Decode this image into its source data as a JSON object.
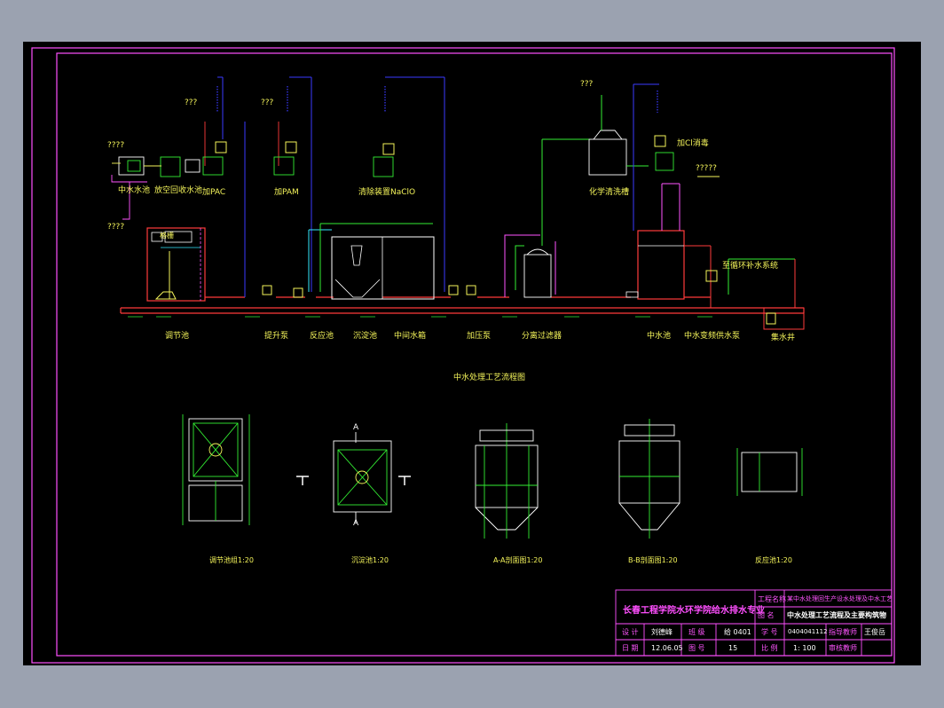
{
  "flow_title": "中水处理工艺流程图",
  "process_labels": {
    "reuse_pool": "中水水池",
    "air_dryer": "放空回收水池",
    "pac": "加PAC",
    "pam": "加PAM",
    "naclo": "清除装置NaClO",
    "chem_clean": "化学清洗槽",
    "cl_disinfect": "加Cl消毒",
    "reuse_system": "至循环补水系统",
    "equalization": "调节池",
    "lift_pump": "提升泵",
    "reaction": "反应池",
    "sedimentation": "沉淀池",
    "intermediate": "中间水箱",
    "booster": "加压泵",
    "membrane": "分离过滤器",
    "reuse_tank": "中水池",
    "reuse_pump": "中水变频供水泵",
    "collect_well": "集水井",
    "tank_tag": "格栅"
  },
  "unknown_marks": {
    "q4a": "????",
    "q4b": "????",
    "q3a": "???",
    "q3b": "???",
    "q3c": "???",
    "q3d": "???",
    "q5": "?????"
  },
  "section_labels": {
    "sec1": "调节池组1:20",
    "sec2": "沉淀池1:20",
    "sec3": "A-A剖面图1:20",
    "sec4": "B-B剖面图1:20",
    "sec5": "反应池1:20",
    "markA": "A",
    "markA2": "A"
  },
  "title_block": {
    "school": "长春工程学院水环学院给水排水专业",
    "project_label": "工程名称",
    "project_value": "某中水处理回生产设水处理及中水工艺",
    "drawing_label": "图  名",
    "drawing_value": "中水处理工艺流程及主要构筑物",
    "design_label": "设  计",
    "design_value": "刘德峰",
    "class_label": "班  级",
    "class_value": "给 0401",
    "student_no_label": "学  号",
    "student_no_value": "0404041112",
    "advisor_label": "指导教师",
    "advisor_value": "王俊岳",
    "date_label": "日  期",
    "date_value": "12.06.05",
    "sheet_label": "图  号",
    "sheet_value": "15",
    "scale_label": "比  例",
    "scale_value": "1: 100",
    "check_label": "审核教师"
  },
  "colors": {
    "background": "#9ba2b0",
    "sheet": "#000000",
    "border": "#ff4fff",
    "pipe_main": "#ff3b3b",
    "pipe_blue": "#3a3aff",
    "pipe_green": "#33ee33",
    "pipe_cyan": "#33e8ff",
    "text": "#f4f45a"
  }
}
